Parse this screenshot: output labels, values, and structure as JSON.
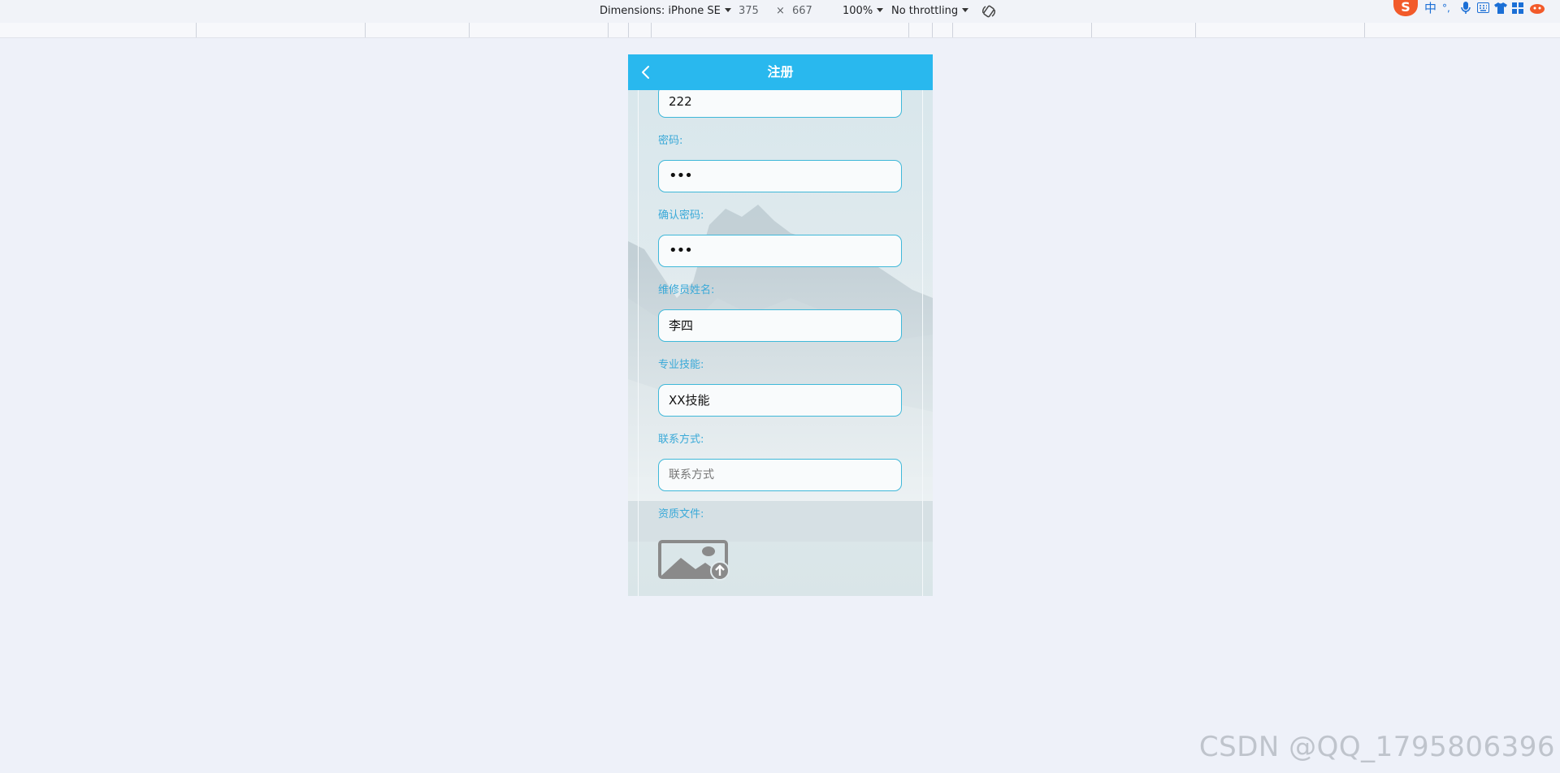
{
  "toolbar": {
    "dimensions_label": "Dimensions: iPhone SE",
    "width": "375",
    "times": "×",
    "height": "667",
    "zoom": "100%",
    "throttling": "No throttling"
  },
  "ime": {
    "logo": "S",
    "mode": "中"
  },
  "phone": {
    "title": "注册",
    "fields": [
      {
        "kind": "input",
        "value": "222"
      },
      {
        "kind": "label",
        "text": "密码:"
      },
      {
        "kind": "input",
        "value": "•••"
      },
      {
        "kind": "label",
        "text": "确认密码:"
      },
      {
        "kind": "input",
        "value": "•••"
      },
      {
        "kind": "label",
        "text": "维修员姓名:"
      },
      {
        "kind": "input",
        "value": "李四"
      },
      {
        "kind": "label",
        "text": "专业技能:"
      },
      {
        "kind": "input",
        "value": "XX技能"
      },
      {
        "kind": "label",
        "text": "联系方式:"
      },
      {
        "kind": "input",
        "placeholder": "联系方式"
      },
      {
        "kind": "label",
        "text": "资质文件:"
      }
    ]
  },
  "watermark": "CSDN @QQ_1795806396",
  "colors": {
    "navbar": "#29b8ee",
    "label": "#39a9d8",
    "input_border": "#3fb8d9",
    "page_bg": "#eef1f9"
  }
}
